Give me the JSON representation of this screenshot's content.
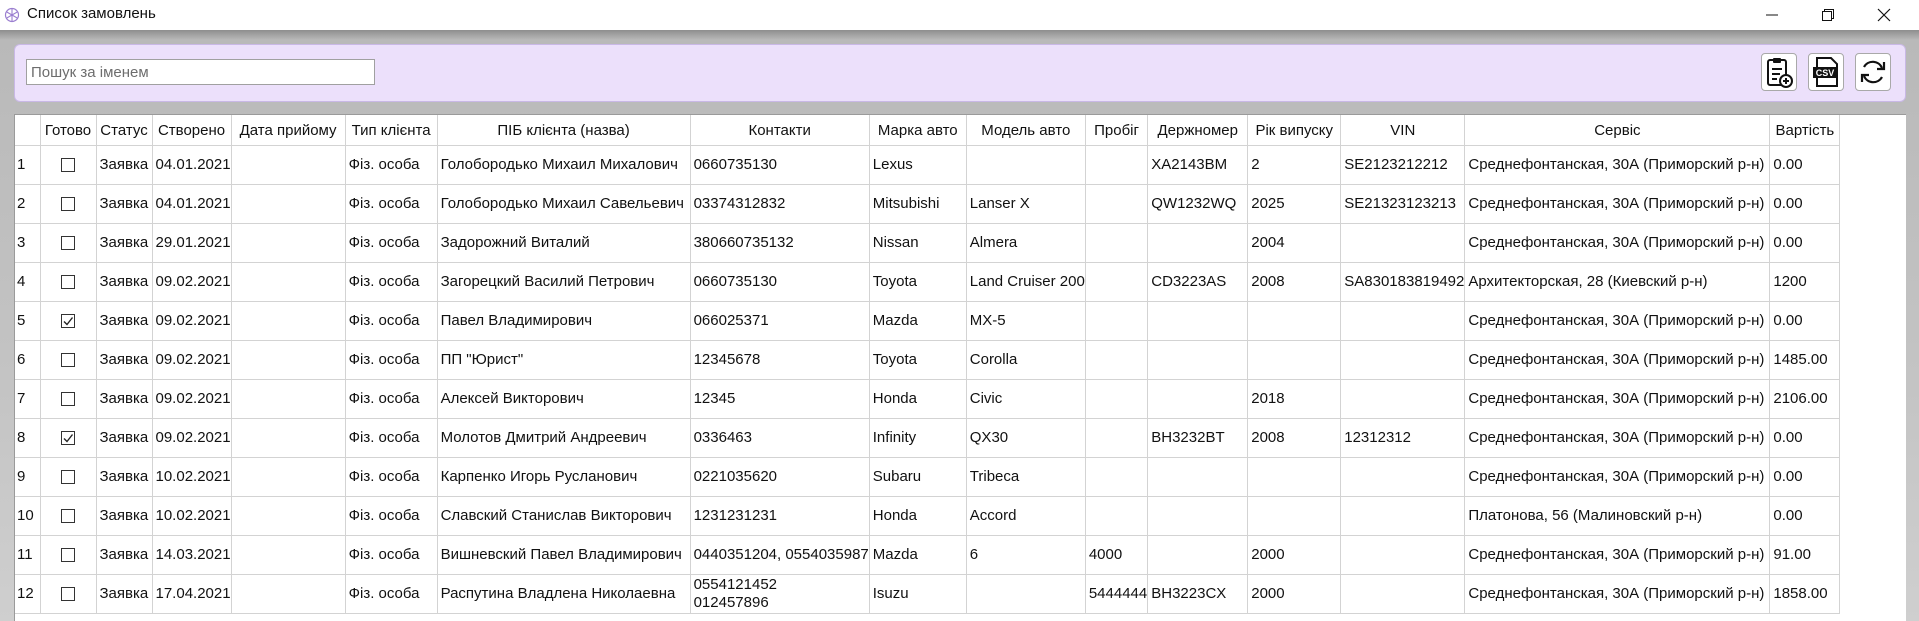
{
  "window": {
    "title": "Список замовлень",
    "icon": "snowflake-icon"
  },
  "search": {
    "placeholder": "Пошук за іменем",
    "value": ""
  },
  "toolbar": {
    "buttons": [
      {
        "icon": "clipboard-add-icon",
        "label": ""
      },
      {
        "icon": "csv-file-icon",
        "label": "CSV"
      },
      {
        "icon": "refresh-icon",
        "label": ""
      }
    ]
  },
  "table": {
    "columns": [
      "Готово",
      "Статус",
      "Створено",
      "Дата прийому",
      "Тип клієнта",
      "ПІБ клієнта (назва)",
      "Контакти",
      "Марка авто",
      "Модель авто",
      "Пробіг",
      "Держномер",
      "Рік випуску",
      "VIN",
      "Сервіс",
      "Вартість"
    ],
    "rows": [
      {
        "num": "1",
        "done": false,
        "status": "Заявка",
        "created": "04.01.2021",
        "received": "",
        "client_type": "Фіз. особа",
        "name": "Голобородько Михаил Михалович",
        "contacts": "0660735130",
        "make": "Lexus",
        "model": "",
        "mileage": "",
        "plate": "XA2143BM",
        "year": "2",
        "vin": "SE2123212212",
        "service": "Среднефонтанская, 30А (Приморский р-н)",
        "price": "0.00"
      },
      {
        "num": "2",
        "done": false,
        "status": "Заявка",
        "created": "04.01.2021",
        "received": "",
        "client_type": "Фіз. особа",
        "name": "Голобородько Михаил Савельевич",
        "contacts": "03374312832",
        "make": "Mitsubishi",
        "model": "Lanser X",
        "mileage": "",
        "plate": "QW1232WQ",
        "year": "2025",
        "vin": "SE21323123213",
        "service": "Среднефонтанская, 30А (Приморский р-н)",
        "price": "0.00"
      },
      {
        "num": "3",
        "done": false,
        "status": "Заявка",
        "created": "29.01.2021",
        "received": "",
        "client_type": "Фіз. особа",
        "name": "Задорожний Виталий",
        "contacts": "380660735132",
        "make": "Nissan",
        "model": "Almera",
        "mileage": "",
        "plate": "",
        "year": "2004",
        "vin": "",
        "service": "Среднефонтанская, 30А (Приморский р-н)",
        "price": "0.00"
      },
      {
        "num": "4",
        "done": false,
        "status": "Заявка",
        "created": "09.02.2021",
        "received": "",
        "client_type": "Фіз. особа",
        "name": "Загорецкий Василий Петрович",
        "contacts": "0660735130",
        "make": "Toyota",
        "model": "Land Cruiser 200",
        "mileage": "",
        "plate": "CD3223AS",
        "year": "2008",
        "vin": "SA830183819492",
        "service": "Архитекторская, 28 (Киевский р-н)",
        "price": "1200"
      },
      {
        "num": "5",
        "done": true,
        "status": "Заявка",
        "created": "09.02.2021",
        "received": "",
        "client_type": "Фіз. особа",
        "name": "Павел Владимирович",
        "contacts": "066025371",
        "make": "Mazda",
        "model": "MX-5",
        "mileage": "",
        "plate": "",
        "year": "",
        "vin": "",
        "service": "Среднефонтанская, 30А (Приморский р-н)",
        "price": "0.00"
      },
      {
        "num": "6",
        "done": false,
        "status": "Заявка",
        "created": "09.02.2021",
        "received": "",
        "client_type": "Фіз. особа",
        "name": "ПП \"Юрист\"",
        "contacts": "12345678",
        "make": "Toyota",
        "model": "Corolla",
        "mileage": "",
        "plate": "",
        "year": "",
        "vin": "",
        "service": "Среднефонтанская, 30А (Приморский р-н)",
        "price": "1485.00"
      },
      {
        "num": "7",
        "done": false,
        "status": "Заявка",
        "created": "09.02.2021",
        "received": "",
        "client_type": "Фіз. особа",
        "name": "Алексей Викторович",
        "contacts": "12345",
        "make": "Honda",
        "model": "Civic",
        "mileage": "",
        "plate": "",
        "year": "2018",
        "vin": "",
        "service": "Среднефонтанская, 30А (Приморский р-н)",
        "price": "2106.00"
      },
      {
        "num": "8",
        "done": true,
        "status": "Заявка",
        "created": "09.02.2021",
        "received": "",
        "client_type": "Фіз. особа",
        "name": "Молотов Дмитрий Андреевич",
        "contacts": "0336463",
        "make": "Infinity",
        "model": "QX30",
        "mileage": "",
        "plate": "BH3232BT",
        "year": "2008",
        "vin": "12312312",
        "service": "Среднефонтанская, 30А (Приморский р-н)",
        "price": "0.00"
      },
      {
        "num": "9",
        "done": false,
        "status": "Заявка",
        "created": "10.02.2021",
        "received": "",
        "client_type": "Фіз. особа",
        "name": "Карпенко Игорь Русланович",
        "contacts": "0221035620",
        "make": "Subaru",
        "model": "Tribeca",
        "mileage": "",
        "plate": "",
        "year": "",
        "vin": "",
        "service": "Среднефонтанская, 30А (Приморский р-н)",
        "price": "0.00"
      },
      {
        "num": "10",
        "done": false,
        "status": "Заявка",
        "created": "10.02.2021",
        "received": "",
        "client_type": "Фіз. особа",
        "name": "Славский Станислав Викторович",
        "contacts": "1231231231",
        "make": "Honda",
        "model": "Accord",
        "mileage": "",
        "plate": "",
        "year": "",
        "vin": "",
        "service": "Платонова, 56 (Малиновский р-н)",
        "price": "0.00"
      },
      {
        "num": "11",
        "done": false,
        "status": "Заявка",
        "created": "14.03.2021",
        "received": "",
        "client_type": "Фіз. особа",
        "name": "Вишневский Павел Владимирович",
        "contacts": "0440351204, 0554035987",
        "make": "Mazda",
        "model": "6",
        "mileage": "4000",
        "plate": "",
        "year": "2000",
        "vin": "",
        "service": "Среднефонтанская, 30А (Приморский р-н)",
        "price": "91.00"
      },
      {
        "num": "12",
        "done": false,
        "status": "Заявка",
        "created": "17.04.2021",
        "received": "",
        "client_type": "Фіз. особа",
        "name": "Распутина Владлена Николаевна",
        "contacts": "0554121452\n012457896",
        "make": "Isuzu",
        "model": "",
        "mileage": "5444444",
        "plate": "BH3223CX",
        "year": "2000",
        "vin": "",
        "service": "Среднефонтанская, 30А (Приморский р-н)",
        "price": "1858.00"
      }
    ]
  }
}
